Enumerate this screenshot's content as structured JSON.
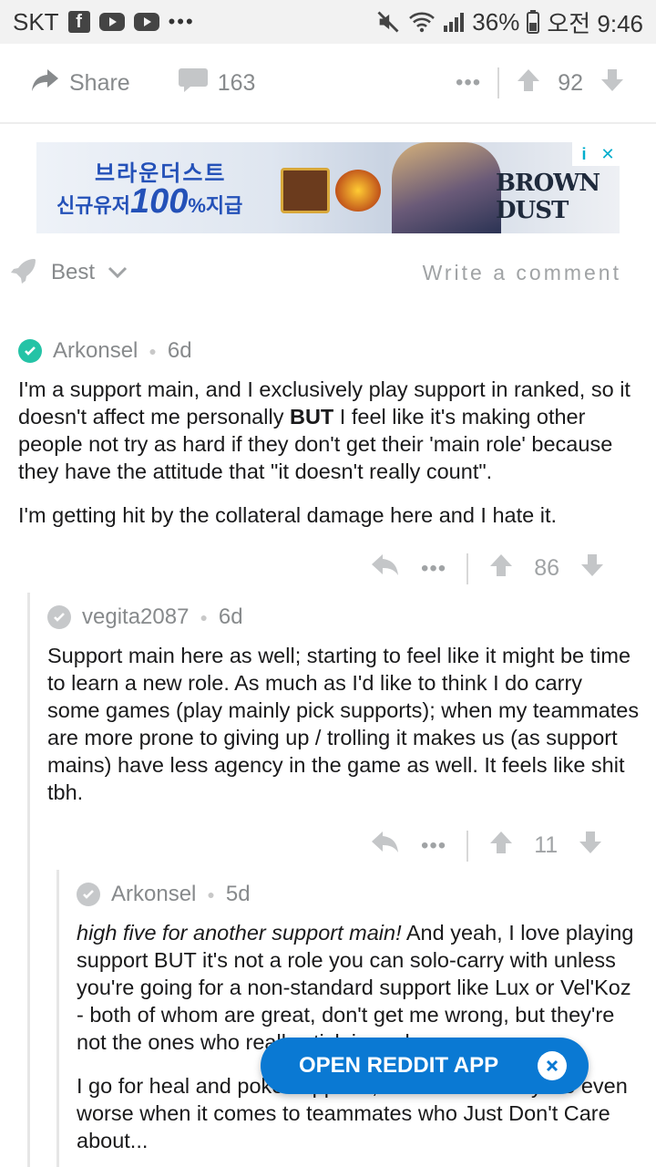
{
  "status_bar": {
    "carrier": "SKT",
    "more": "•••",
    "battery": "36%",
    "time": "오전 9:46",
    "icons": [
      "facebook-icon",
      "youtube-icon",
      "youtube-icon",
      "mute-icon",
      "wifi-icon",
      "signal-icon",
      "battery-icon"
    ]
  },
  "post_actions": {
    "share_label": "Share",
    "comment_count": "163",
    "more": "•••",
    "score": "92"
  },
  "ad": {
    "line1": "브라운더스트",
    "line2_prefix": "신규유저",
    "line2_big": "100",
    "line2_suffix": "%지급",
    "brand": "BROWN DUST",
    "info": "i",
    "close": "✕"
  },
  "sort_bar": {
    "sort_label": "Best",
    "write_comment": "Write a comment"
  },
  "comments": [
    {
      "author": "Arkonsel",
      "age": "6d",
      "body_p1_a": "I'm a support main, and I exclusively play support in ranked, so it doesn't affect me personally ",
      "body_p1_bold": "BUT",
      "body_p1_b": " I feel like it's making other people not try as hard if they don't get their 'main role' because they have the attitude that \"it doesn't really count\".",
      "body_p2": "I'm getting hit by the collateral damage here and I hate it.",
      "score": "86",
      "more": "•••"
    },
    {
      "author": "vegita2087",
      "age": "6d",
      "body_p1": "Support main here as well; starting to feel like it might be time to learn a new role. As much as I'd like to think I do carry some games (play mainly pick supports); when my teammates are more prone to giving up / trolling it makes us (as support mains) have less agency in the game as well. It feels like shit tbh.",
      "score": "11",
      "more": "•••"
    },
    {
      "author": "Arkonsel",
      "age": "5d",
      "body_p1_italic": "high five for another support main!",
      "body_p1_rest": " And yeah, I love playing support BUT it's not a role you can solo-carry with unless you're going for a non-standard support like Lux or Vel'Koz - both of whom are great, don't get me wrong, but they're not the ones who really stick in rank.",
      "body_p2": "I go for heal and poke supports, which makes my life even worse when it comes to teammates who Just Don't Care about..."
    }
  ],
  "open_app_button": {
    "label": "OPEN REDDIT APP"
  },
  "colors": {
    "brand_blue": "#0a79d3",
    "verified_teal": "#24c3a6",
    "muted_gray": "#878a8c"
  }
}
